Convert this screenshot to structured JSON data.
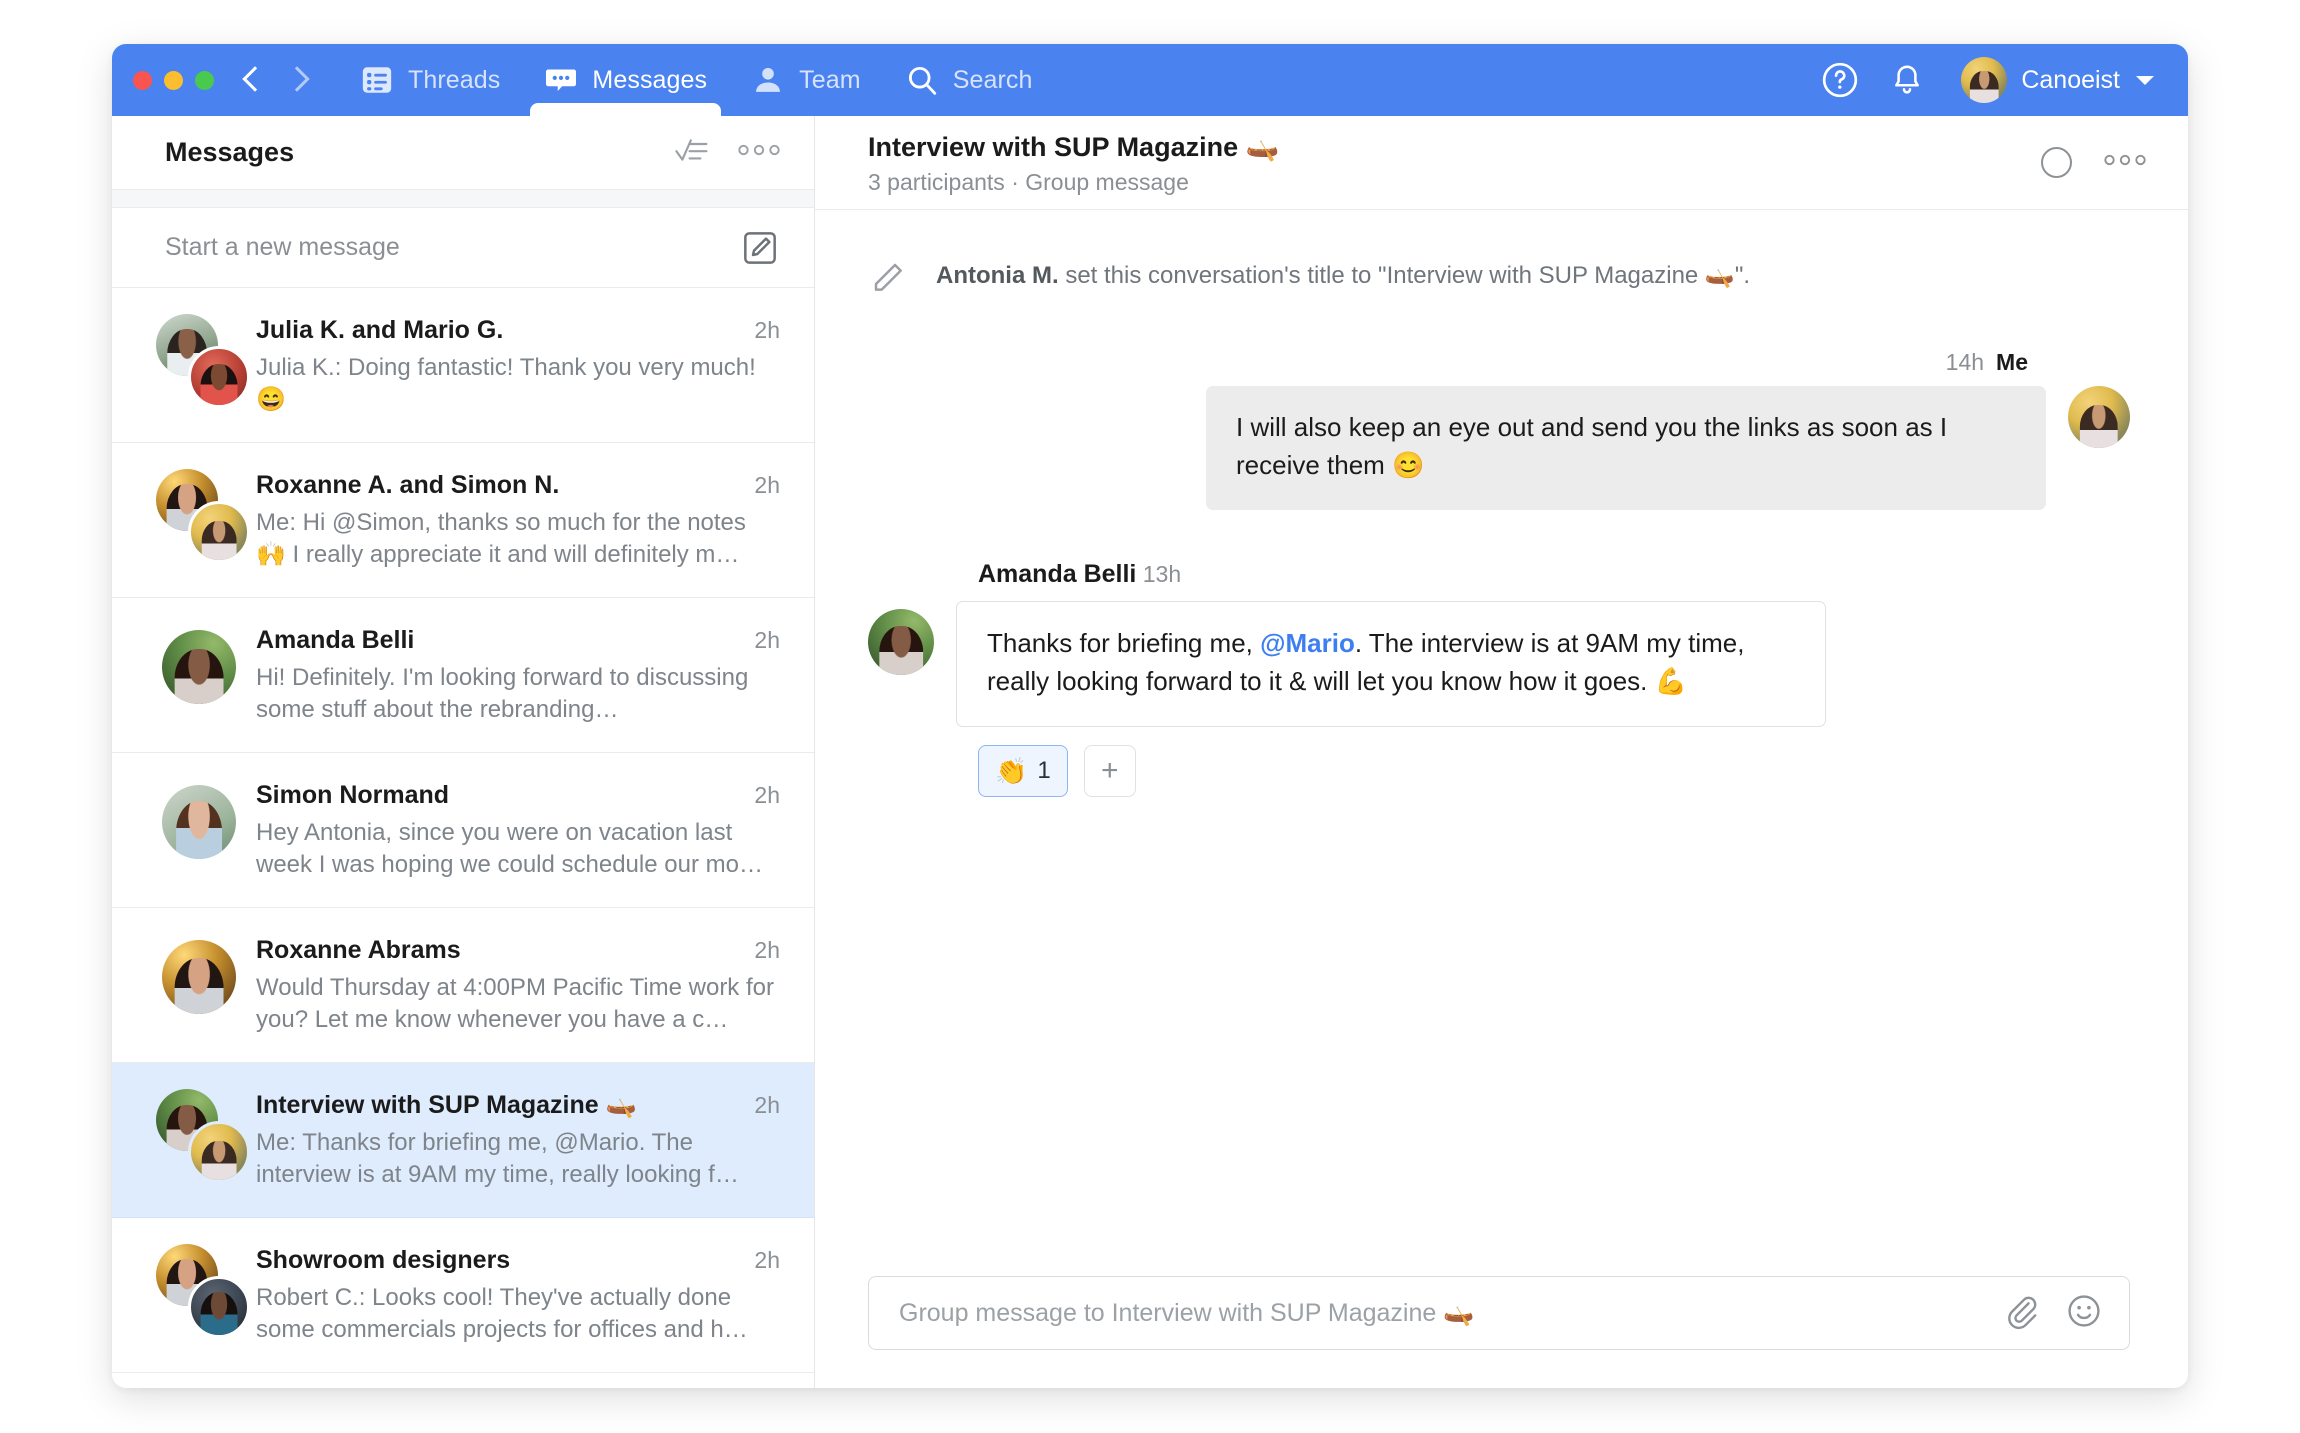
{
  "colors": {
    "accent": "#4a82f0",
    "selected_row": "#dfecfd",
    "mention": "#3d7ff0",
    "bubble_out": "#ececec"
  },
  "topbar": {
    "window_controls": [
      "close",
      "minimize",
      "zoom"
    ],
    "back_label": "Back",
    "forward_label": "Forward",
    "tabs": [
      {
        "id": "threads",
        "label": "Threads",
        "icon": "list-icon",
        "active": false
      },
      {
        "id": "messages",
        "label": "Messages",
        "icon": "chat-bubble-icon",
        "active": true
      },
      {
        "id": "team",
        "label": "Team",
        "icon": "person-icon",
        "active": false
      },
      {
        "id": "search",
        "label": "Search",
        "icon": "search-icon",
        "active": false
      }
    ],
    "help_icon": "question-circle-icon",
    "notifications_icon": "bell-icon",
    "user": {
      "name": "Canoeist",
      "avatar": "user-avatar",
      "caret": "chevron-down-icon"
    }
  },
  "sidebar": {
    "title": "Messages",
    "mark_all_read_icon": "checklist-icon",
    "more_icon": "more-horizontal-icon",
    "new_message": {
      "placeholder": "Start a new message",
      "compose_icon": "compose-pencil-icon"
    },
    "conversations": [
      {
        "name": "Julia K. and Mario G.",
        "snippet": "Julia K.: Doing fantastic! Thank you very much! 😄",
        "time": "2h",
        "avatars": [
          "mario",
          "julia"
        ],
        "selected": false
      },
      {
        "name": "Roxanne A. and Simon N.",
        "snippet": "Me: Hi @Simon, thanks so much for the notes 🙌 I really appreciate it and will definitely m…",
        "time": "2h",
        "avatars": [
          "roxanne",
          "me"
        ],
        "selected": false
      },
      {
        "name": "Amanda Belli",
        "snippet": "Hi! Definitely. I'm looking forward to discussing some stuff about the rebranding…",
        "time": "2h",
        "avatars": [
          "amanda"
        ],
        "selected": false
      },
      {
        "name": "Simon Normand",
        "snippet": "Hey Antonia, since you were on vacation last week I was hoping we could schedule our mo…",
        "time": "2h",
        "avatars": [
          "simon"
        ],
        "selected": false
      },
      {
        "name": "Roxanne Abrams",
        "snippet": "Would Thursday at 4:00PM Pacific Time work for you? Let me know whenever you have a c…",
        "time": "2h",
        "avatars": [
          "roxanne"
        ],
        "selected": false
      },
      {
        "name": "Interview with SUP Magazine 🛶",
        "snippet": "Me: Thanks for briefing me, @Mario. The interview is at 9AM my time, really looking f…",
        "time": "2h",
        "avatars": [
          "amanda",
          "me"
        ],
        "selected": true
      },
      {
        "name": "Showroom designers",
        "snippet": "Robert C.: Looks cool! They've actually done some commercials projects for offices and h…",
        "time": "2h",
        "avatars": [
          "roxanne",
          "robert"
        ],
        "selected": false
      }
    ]
  },
  "conversation": {
    "title": "Interview with SUP Magazine 🛶",
    "subtitle": "3 participants · Group message",
    "status_circle_icon": "unread-circle-icon",
    "more_icon": "more-horizontal-icon",
    "system_message": {
      "icon": "pencil-icon",
      "actor": "Antonia M.",
      "text": " set this conversation's title to \"Interview with SUP Magazine 🛶\"."
    },
    "messages": [
      {
        "direction": "outgoing",
        "author": "Me",
        "time": "14h",
        "text": "I will also keep an eye out and send you the links as soon as I receive them 😊",
        "avatar": "me"
      },
      {
        "direction": "incoming",
        "author": "Amanda Belli",
        "time": "13h",
        "text_before_mention": "Thanks for briefing me, ",
        "mention": "@Mario",
        "text_after_mention": ". The interview is at 9AM my time, really looking forward to it & will let you know how it goes. 💪",
        "avatar": "amanda",
        "reactions": [
          {
            "emoji": "👏",
            "count": "1",
            "active": true
          }
        ],
        "add_reaction_label": "+"
      }
    ],
    "composer": {
      "placeholder": "Group message to Interview with SUP Magazine 🛶",
      "attach_icon": "paperclip-icon",
      "emoji_icon": "smiley-icon"
    }
  }
}
